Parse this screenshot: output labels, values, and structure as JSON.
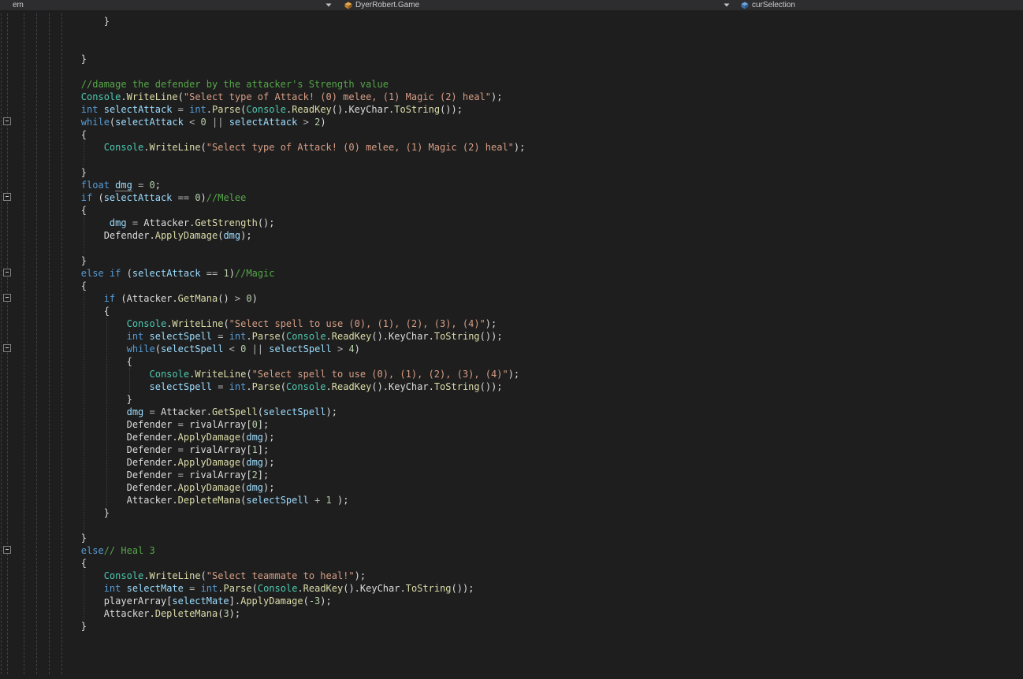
{
  "nav_bar": {
    "project_dropdown": {
      "label": "em",
      "chevron_icon": "chevron-down-icon"
    },
    "type_dropdown": {
      "label": "DyerRobert.Game",
      "icon": "class-icon",
      "chevron_icon": "chevron-down-icon"
    },
    "member_dropdown": {
      "label": "curSelection",
      "icon": "field-icon"
    }
  },
  "palette": {
    "background": "#1E1E1E",
    "nav_background": "#2D2D30",
    "nav_text": "#CCCCCC",
    "keyword": "#569CD6",
    "comment": "#57A64A",
    "string": "#D69D85",
    "number": "#B5CEA8",
    "type": "#4EC9B0",
    "method": "#DCDCAA",
    "local": "#9CDCFE",
    "plain": "#DCDCDC",
    "operator": "#B4B4B4",
    "guide": "#3F3F46",
    "fold_border": "#808080"
  },
  "editor": {
    "language": "csharp",
    "fold_lines": [
      9,
      15,
      21,
      23,
      27,
      43
    ],
    "lines": [
      [
        [
          "p",
          "            }"
        ]
      ],
      [],
      [],
      [
        [
          "p",
          "        }"
        ]
      ],
      [],
      [
        [
          "p",
          "        "
        ],
        [
          "c",
          "//damage the defender by the attacker's Strength value"
        ]
      ],
      [
        [
          "p",
          "        "
        ],
        [
          "cl",
          "Console"
        ],
        [
          "p",
          "."
        ],
        [
          "m",
          "WriteLine"
        ],
        [
          "p",
          "("
        ],
        [
          "s",
          "\"Select type of Attack! (0) melee, (1) Magic (2) heal\""
        ],
        [
          "p",
          ");"
        ]
      ],
      [
        [
          "p",
          "        "
        ],
        [
          "k",
          "int"
        ],
        [
          "p",
          " "
        ],
        [
          "v",
          "selectAttack"
        ],
        [
          "o",
          " = "
        ],
        [
          "k",
          "int"
        ],
        [
          "p",
          "."
        ],
        [
          "m",
          "Parse"
        ],
        [
          "p",
          "("
        ],
        [
          "cl",
          "Console"
        ],
        [
          "p",
          "."
        ],
        [
          "m",
          "ReadKey"
        ],
        [
          "p",
          "().KeyChar."
        ],
        [
          "m",
          "ToString"
        ],
        [
          "p",
          "());"
        ]
      ],
      [
        [
          "p",
          "        "
        ],
        [
          "k",
          "while"
        ],
        [
          "p",
          "("
        ],
        [
          "v",
          "selectAttack"
        ],
        [
          "o",
          " < "
        ],
        [
          "n",
          "0"
        ],
        [
          "o",
          " || "
        ],
        [
          "v",
          "selectAttack"
        ],
        [
          "o",
          " > "
        ],
        [
          "n",
          "2"
        ],
        [
          "p",
          ")"
        ]
      ],
      [
        [
          "p",
          "        {"
        ]
      ],
      [
        [
          "p",
          "            "
        ],
        [
          "cl",
          "Console"
        ],
        [
          "p",
          "."
        ],
        [
          "m",
          "WriteLine"
        ],
        [
          "p",
          "("
        ],
        [
          "s",
          "\"Select type of Attack! (0) melee, (1) Magic (2) heal\""
        ],
        [
          "p",
          ");"
        ]
      ],
      [],
      [
        [
          "p",
          "        }"
        ]
      ],
      [
        [
          "p",
          "        "
        ],
        [
          "k",
          "float"
        ],
        [
          "p",
          " "
        ],
        [
          "vu",
          "dmg"
        ],
        [
          "o",
          " = "
        ],
        [
          "n",
          "0"
        ],
        [
          "p",
          ";"
        ]
      ],
      [
        [
          "p",
          "        "
        ],
        [
          "k",
          "if"
        ],
        [
          "p",
          " ("
        ],
        [
          "v",
          "selectAttack"
        ],
        [
          "o",
          " == "
        ],
        [
          "n",
          "0"
        ],
        [
          "p",
          ")"
        ],
        [
          "c",
          "//Melee"
        ]
      ],
      [
        [
          "p",
          "        {"
        ]
      ],
      [
        [
          "p",
          "             "
        ],
        [
          "v",
          "dmg"
        ],
        [
          "o",
          " = "
        ],
        [
          "p",
          "Attacker."
        ],
        [
          "m",
          "GetStrength"
        ],
        [
          "p",
          "();"
        ]
      ],
      [
        [
          "p",
          "            Defender."
        ],
        [
          "m",
          "ApplyDamage"
        ],
        [
          "p",
          "("
        ],
        [
          "v",
          "dmg"
        ],
        [
          "p",
          ");"
        ]
      ],
      [],
      [
        [
          "p",
          "        }"
        ]
      ],
      [
        [
          "p",
          "        "
        ],
        [
          "k",
          "else"
        ],
        [
          "p",
          " "
        ],
        [
          "k",
          "if"
        ],
        [
          "p",
          " ("
        ],
        [
          "v",
          "selectAttack"
        ],
        [
          "o",
          " == "
        ],
        [
          "n",
          "1"
        ],
        [
          "p",
          ")"
        ],
        [
          "c",
          "//Magic"
        ]
      ],
      [
        [
          "p",
          "        {"
        ]
      ],
      [
        [
          "p",
          "            "
        ],
        [
          "k",
          "if"
        ],
        [
          "p",
          " (Attacker."
        ],
        [
          "m",
          "GetMana"
        ],
        [
          "p",
          "()"
        ],
        [
          "o",
          " > "
        ],
        [
          "n",
          "0"
        ],
        [
          "p",
          ")"
        ]
      ],
      [
        [
          "p",
          "            {"
        ]
      ],
      [
        [
          "p",
          "                "
        ],
        [
          "cl",
          "Console"
        ],
        [
          "p",
          "."
        ],
        [
          "m",
          "WriteLine"
        ],
        [
          "p",
          "("
        ],
        [
          "s",
          "\"Select spell to use (0), (1), (2), (3), (4)\""
        ],
        [
          "p",
          ");"
        ]
      ],
      [
        [
          "p",
          "                "
        ],
        [
          "k",
          "int"
        ],
        [
          "p",
          " "
        ],
        [
          "v",
          "selectSpell"
        ],
        [
          "o",
          " = "
        ],
        [
          "k",
          "int"
        ],
        [
          "p",
          "."
        ],
        [
          "m",
          "Parse"
        ],
        [
          "p",
          "("
        ],
        [
          "cl",
          "Console"
        ],
        [
          "p",
          "."
        ],
        [
          "m",
          "ReadKey"
        ],
        [
          "p",
          "().KeyChar."
        ],
        [
          "m",
          "ToString"
        ],
        [
          "p",
          "());"
        ]
      ],
      [
        [
          "p",
          "                "
        ],
        [
          "k",
          "while"
        ],
        [
          "p",
          "("
        ],
        [
          "v",
          "selectSpell"
        ],
        [
          "o",
          " < "
        ],
        [
          "n",
          "0"
        ],
        [
          "o",
          " || "
        ],
        [
          "v",
          "selectSpell"
        ],
        [
          "o",
          " > "
        ],
        [
          "n",
          "4"
        ],
        [
          "p",
          ")"
        ]
      ],
      [
        [
          "p",
          "                {"
        ]
      ],
      [
        [
          "p",
          "                    "
        ],
        [
          "cl",
          "Console"
        ],
        [
          "p",
          "."
        ],
        [
          "m",
          "WriteLine"
        ],
        [
          "p",
          "("
        ],
        [
          "s",
          "\"Select spell to use (0), (1), (2), (3), (4)\""
        ],
        [
          "p",
          ");"
        ]
      ],
      [
        [
          "p",
          "                    "
        ],
        [
          "v",
          "selectSpell"
        ],
        [
          "o",
          " = "
        ],
        [
          "k",
          "int"
        ],
        [
          "p",
          "."
        ],
        [
          "m",
          "Parse"
        ],
        [
          "p",
          "("
        ],
        [
          "cl",
          "Console"
        ],
        [
          "p",
          "."
        ],
        [
          "m",
          "ReadKey"
        ],
        [
          "p",
          "().KeyChar."
        ],
        [
          "m",
          "ToString"
        ],
        [
          "p",
          "());"
        ]
      ],
      [
        [
          "p",
          "                }"
        ]
      ],
      [
        [
          "p",
          "                "
        ],
        [
          "v",
          "dmg"
        ],
        [
          "o",
          " = "
        ],
        [
          "p",
          "Attacker."
        ],
        [
          "m",
          "GetSpell"
        ],
        [
          "p",
          "("
        ],
        [
          "v",
          "selectSpell"
        ],
        [
          "p",
          ");"
        ]
      ],
      [
        [
          "p",
          "                Defender"
        ],
        [
          "o",
          " = "
        ],
        [
          "p",
          "rivalArray["
        ],
        [
          "n",
          "0"
        ],
        [
          "p",
          "];"
        ]
      ],
      [
        [
          "p",
          "                Defender."
        ],
        [
          "m",
          "ApplyDamage"
        ],
        [
          "p",
          "("
        ],
        [
          "v",
          "dmg"
        ],
        [
          "p",
          ");"
        ]
      ],
      [
        [
          "p",
          "                Defender"
        ],
        [
          "o",
          " = "
        ],
        [
          "p",
          "rivalArray["
        ],
        [
          "n",
          "1"
        ],
        [
          "p",
          "];"
        ]
      ],
      [
        [
          "p",
          "                Defender."
        ],
        [
          "m",
          "ApplyDamage"
        ],
        [
          "p",
          "("
        ],
        [
          "v",
          "dmg"
        ],
        [
          "p",
          ");"
        ]
      ],
      [
        [
          "p",
          "                Defender"
        ],
        [
          "o",
          " = "
        ],
        [
          "p",
          "rivalArray["
        ],
        [
          "n",
          "2"
        ],
        [
          "p",
          "];"
        ]
      ],
      [
        [
          "p",
          "                Defender."
        ],
        [
          "m",
          "ApplyDamage"
        ],
        [
          "p",
          "("
        ],
        [
          "v",
          "dmg"
        ],
        [
          "p",
          ");"
        ]
      ],
      [
        [
          "p",
          "                Attacker."
        ],
        [
          "m",
          "DepleteMana"
        ],
        [
          "p",
          "("
        ],
        [
          "v",
          "selectSpell"
        ],
        [
          "o",
          " + "
        ],
        [
          "n",
          "1"
        ],
        [
          "p",
          " );"
        ]
      ],
      [
        [
          "p",
          "            }"
        ]
      ],
      [],
      [
        [
          "p",
          "        }"
        ]
      ],
      [
        [
          "p",
          "        "
        ],
        [
          "k",
          "else"
        ],
        [
          "c",
          "// Heal 3"
        ]
      ],
      [
        [
          "p",
          "        {"
        ]
      ],
      [
        [
          "p",
          "            "
        ],
        [
          "cl",
          "Console"
        ],
        [
          "p",
          "."
        ],
        [
          "m",
          "WriteLine"
        ],
        [
          "p",
          "("
        ],
        [
          "s",
          "\"Select teammate to heal!\""
        ],
        [
          "p",
          ");"
        ]
      ],
      [
        [
          "p",
          "            "
        ],
        [
          "k",
          "int"
        ],
        [
          "p",
          " "
        ],
        [
          "v",
          "selectMate"
        ],
        [
          "o",
          " = "
        ],
        [
          "k",
          "int"
        ],
        [
          "p",
          "."
        ],
        [
          "m",
          "Parse"
        ],
        [
          "p",
          "("
        ],
        [
          "cl",
          "Console"
        ],
        [
          "p",
          "."
        ],
        [
          "m",
          "ReadKey"
        ],
        [
          "p",
          "().KeyChar."
        ],
        [
          "m",
          "ToString"
        ],
        [
          "p",
          "());"
        ]
      ],
      [
        [
          "p",
          "            playerArray["
        ],
        [
          "v",
          "selectMate"
        ],
        [
          "p",
          "]."
        ],
        [
          "m",
          "ApplyDamage"
        ],
        [
          "p",
          "("
        ],
        [
          "n",
          "-3"
        ],
        [
          "p",
          ");"
        ]
      ],
      [
        [
          "p",
          "            Attacker."
        ],
        [
          "m",
          "DepleteMana"
        ],
        [
          "p",
          "("
        ],
        [
          "n",
          "3"
        ],
        [
          "p",
          ");"
        ]
      ],
      [
        [
          "p",
          "        }"
        ]
      ]
    ]
  }
}
